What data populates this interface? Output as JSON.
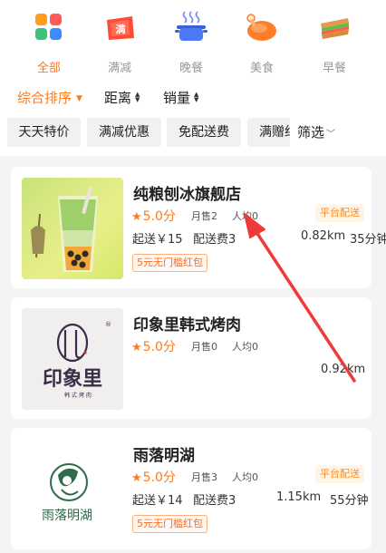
{
  "categories": [
    {
      "label": "全部",
      "icon": "all-grid-icon",
      "active": true
    },
    {
      "label": "满减",
      "icon": "discount-ticket-icon",
      "active": false,
      "icon_text": "满"
    },
    {
      "label": "晚餐",
      "icon": "dinner-pot-icon",
      "active": false
    },
    {
      "label": "美食",
      "icon": "roast-chicken-icon",
      "active": false
    },
    {
      "label": "早餐",
      "icon": "sandwich-icon",
      "active": false
    }
  ],
  "sort": {
    "comprehensive": "综合排序",
    "distance": "距离",
    "sales": "销量"
  },
  "filters": {
    "chips": [
      "天天特价",
      "满减优惠",
      "免配送费",
      "满赠红包"
    ],
    "more": "筛选"
  },
  "stores": [
    {
      "name": "纯粮刨冰旗舰店",
      "rating": "5.0分",
      "monthly_sales": "月售2",
      "avg_price": "人均0",
      "badge": "平台配送",
      "min_order": "起送￥15",
      "delivery_fee": "配送费3",
      "distance": "0.82km",
      "time": "35分钟",
      "promo": "5元无门槛红包"
    },
    {
      "name": "印象里韩式烤肉",
      "rating": "5.0分",
      "monthly_sales": "月售0",
      "avg_price": "人均0",
      "distance": "0.92km",
      "logo_main": "印象里",
      "logo_sub": "韩 式 烤 肉",
      "logo_mark": "®"
    },
    {
      "name": "雨落明湖",
      "rating": "5.0分",
      "monthly_sales": "月售3",
      "avg_price": "人均0",
      "badge": "平台配送",
      "min_order": "起送￥14",
      "delivery_fee": "配送费3",
      "distance": "1.15km",
      "time": "55分钟",
      "promo": "5元无门槛红包",
      "logo_main": "雨落明湖"
    }
  ],
  "colors": {
    "accent": "#ff7a1a",
    "badge_bg": "#fff4e6",
    "annotation_arrow": "#f03a3a"
  }
}
